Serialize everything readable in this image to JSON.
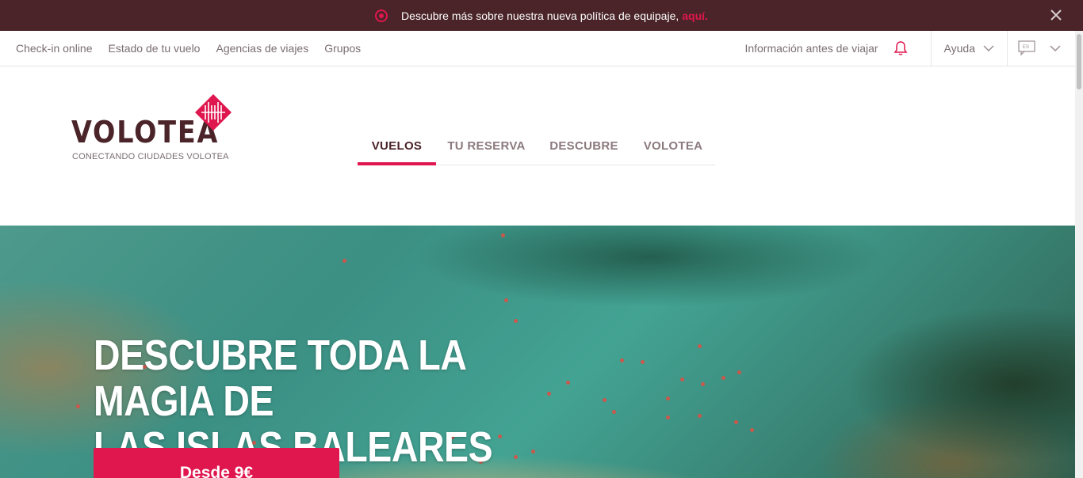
{
  "announcement": {
    "text": "Descubre más sobre nuestra nueva política de equipaje,",
    "link": "aquí."
  },
  "utility_nav": {
    "left": [
      "Check-in online",
      "Estado de tu vuelo",
      "Agencias de viajes",
      "Grupos"
    ],
    "info": "Información antes de viajar",
    "help": "Ayuda",
    "lang": "ES"
  },
  "brand": {
    "name": "VOLOTEA",
    "tagline": "CONECTANDO CIUDADES VOLOTEA",
    "color_primary": "#e0174e",
    "color_dark": "#4a2428"
  },
  "main_nav": {
    "tabs": [
      "VUELOS",
      "TU RESERVA",
      "DESCUBRE",
      "VOLOTEA"
    ],
    "active": "VUELOS"
  },
  "hero": {
    "title_line1": "DESCUBRE TODA LA MAGIA DE",
    "title_line2": "LAS ISLAS BALEARES",
    "cta": "Desde 9€"
  }
}
